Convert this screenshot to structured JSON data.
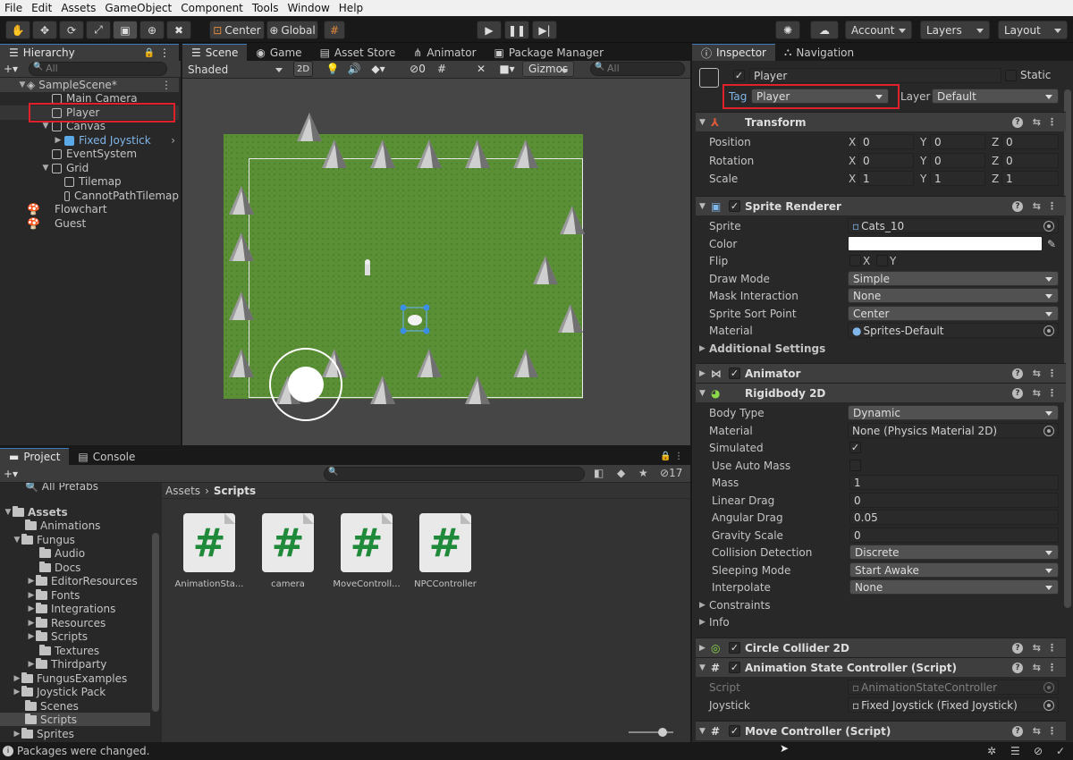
{
  "menu": [
    "File",
    "Edit",
    "Assets",
    "GameObject",
    "Component",
    "Tools",
    "Window",
    "Help"
  ],
  "toolbar": {
    "pivot": "Center",
    "space": "Global",
    "account": "Account",
    "layers": "Layers",
    "layout": "Layout"
  },
  "hierarchy": {
    "title": "Hierarchy",
    "search_placeholder": "All",
    "scene": "SampleScene*",
    "items": [
      "Main Camera",
      "Player",
      "Canvas",
      "Fixed Joystick",
      "EventSystem",
      "Grid",
      "Tilemap",
      "CannotPathTilemap",
      "Flowchart",
      "Guest"
    ]
  },
  "scene_tabs": [
    "Scene",
    "Game",
    "Asset Store",
    "Animator",
    "Package Manager"
  ],
  "scene_toolbar": {
    "shading": "Shaded",
    "mode2d": "2D",
    "fx_count": "0",
    "gizmos": "Gizmos",
    "search_placeholder": "All"
  },
  "project": {
    "tabs": [
      "Project",
      "Console"
    ],
    "hidden_count": "17",
    "tree": [
      "All Prefabs",
      "Assets",
      "Animations",
      "Fungus",
      "Audio",
      "Docs",
      "EditorResources",
      "Fonts",
      "Integrations",
      "Resources",
      "Scripts",
      "Textures",
      "Thirdparty",
      "FungusExamples",
      "Joystick Pack",
      "Scenes",
      "Scripts",
      "Sprites"
    ],
    "breadcrumb": [
      "Assets",
      "Scripts"
    ],
    "files": [
      "AnimationSta...",
      "camera",
      "MoveControll...",
      "NPCController"
    ],
    "file_glyph": "#"
  },
  "inspector": {
    "tabs": [
      "Inspector",
      "Navigation"
    ],
    "object_name": "Player",
    "static_label": "Static",
    "tag_label": "Tag",
    "tag": "Player",
    "layer_label": "Layer",
    "layer": "Default",
    "transform": {
      "title": "Transform",
      "rows": [
        {
          "label": "Position",
          "x": "0",
          "y": "0",
          "z": "0"
        },
        {
          "label": "Rotation",
          "x": "0",
          "y": "0",
          "z": "0"
        },
        {
          "label": "Scale",
          "x": "1",
          "y": "1",
          "z": "1"
        }
      ]
    },
    "axes": [
      "X",
      "Y",
      "Z"
    ],
    "sprite_renderer": {
      "title": "Sprite Renderer",
      "sprite_label": "Sprite",
      "sprite": "Cats_10",
      "color_label": "Color",
      "flip_label": "Flip",
      "flip_x": "X",
      "flip_y": "Y",
      "draw_mode_label": "Draw Mode",
      "draw_mode": "Simple",
      "mask_label": "Mask Interaction",
      "mask": "None",
      "sort_label": "Sprite Sort Point",
      "sort": "Center",
      "material_label": "Material",
      "material": "Sprites-Default",
      "additional": "Additional Settings"
    },
    "animator": {
      "title": "Animator"
    },
    "rigidbody": {
      "title": "Rigidbody 2D",
      "rows": [
        {
          "label": "Body Type",
          "value": "Dynamic"
        },
        {
          "label": "Material",
          "value": "None (Physics Material 2D)"
        },
        {
          "label": "Simulated",
          "value": "✓"
        },
        {
          "label": "Use Auto Mass",
          "value": ""
        },
        {
          "label": "Mass",
          "value": "1"
        },
        {
          "label": "Linear Drag",
          "value": "0"
        },
        {
          "label": "Angular Drag",
          "value": "0.05"
        },
        {
          "label": "Gravity Scale",
          "value": "0"
        },
        {
          "label": "Collision Detection",
          "value": "Discrete"
        },
        {
          "label": "Sleeping Mode",
          "value": "Start Awake"
        },
        {
          "label": "Interpolate",
          "value": "None"
        }
      ],
      "constraints": "Constraints",
      "info": "Info"
    },
    "circle_collider": {
      "title": "Circle Collider 2D"
    },
    "anim_state": {
      "title": "Animation State Controller (Script)",
      "script_label": "Script",
      "script": "AnimationStateController",
      "joystick_label": "Joystick",
      "joystick": "Fixed Joystick (Fixed Joystick)"
    },
    "move_controller": {
      "title": "Move Controller (Script)"
    }
  },
  "status": {
    "message": "Packages were changed."
  },
  "colors": {
    "accent": "#3a79bb",
    "highlight": "#e0202a",
    "script_green": "#1f8a3a",
    "grass": "#4f8a2e"
  }
}
